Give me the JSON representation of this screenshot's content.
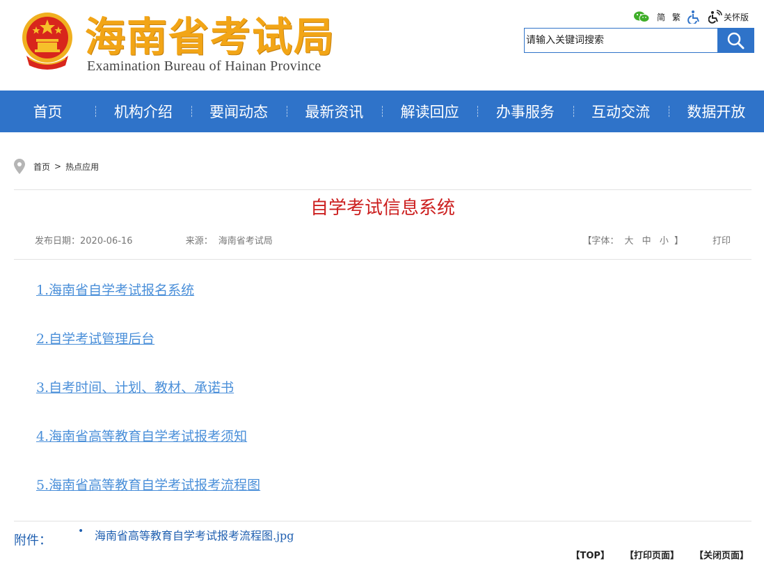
{
  "header": {
    "site_title": "海南省考试局",
    "site_subtitle": "Examination Bureau of Hainan Province",
    "tools": {
      "simplified": "简",
      "traditional": "繁",
      "care_mode": "关怀版"
    },
    "search": {
      "placeholder": "请输入关键词搜索"
    }
  },
  "nav": {
    "items": [
      "首页",
      "机构介绍",
      "要闻动态",
      "最新资讯",
      "解读回应",
      "办事服务",
      "互动交流",
      "数据开放"
    ]
  },
  "breadcrumb": {
    "home": "首页",
    "separator": ">",
    "current": "热点应用"
  },
  "article": {
    "title": "自学考试信息系统",
    "publish_label": "发布日期：",
    "publish_date": "2020-06-16",
    "source_label": "来源：",
    "source_value": "海南省考试局",
    "font_open": "【字体：",
    "font_large": "大",
    "font_medium": "中",
    "font_small": "小",
    "font_close": "】",
    "print": "打印",
    "links": [
      "1.海南省自学考试报名系统",
      "2.自学考试管理后台",
      "3.自考时间、计划、教材、承诺书",
      "4.海南省高等教育自学考试报考须知",
      "5.海南省高等教育自学考试报考流程图"
    ]
  },
  "attachment": {
    "label": "附件：",
    "bullet": "•",
    "file": "海南省高等教育自学考试报考流程图.jpg"
  },
  "footer_links": {
    "top": "【TOP】",
    "print_page": "【打印页面】",
    "close_page": "【关闭页面】"
  },
  "colors": {
    "nav_blue": "#2f73c9",
    "title_red": "#cc1f1f",
    "logo_gold": "#f2a516",
    "link_blue": "#4a8fd9"
  },
  "icons": {
    "emblem": "national-emblem-icon",
    "wechat": "wechat-icon",
    "accessibility": "wheelchair-icon",
    "care": "care-mode-icon",
    "search": "search-icon",
    "location": "location-pin-icon"
  }
}
